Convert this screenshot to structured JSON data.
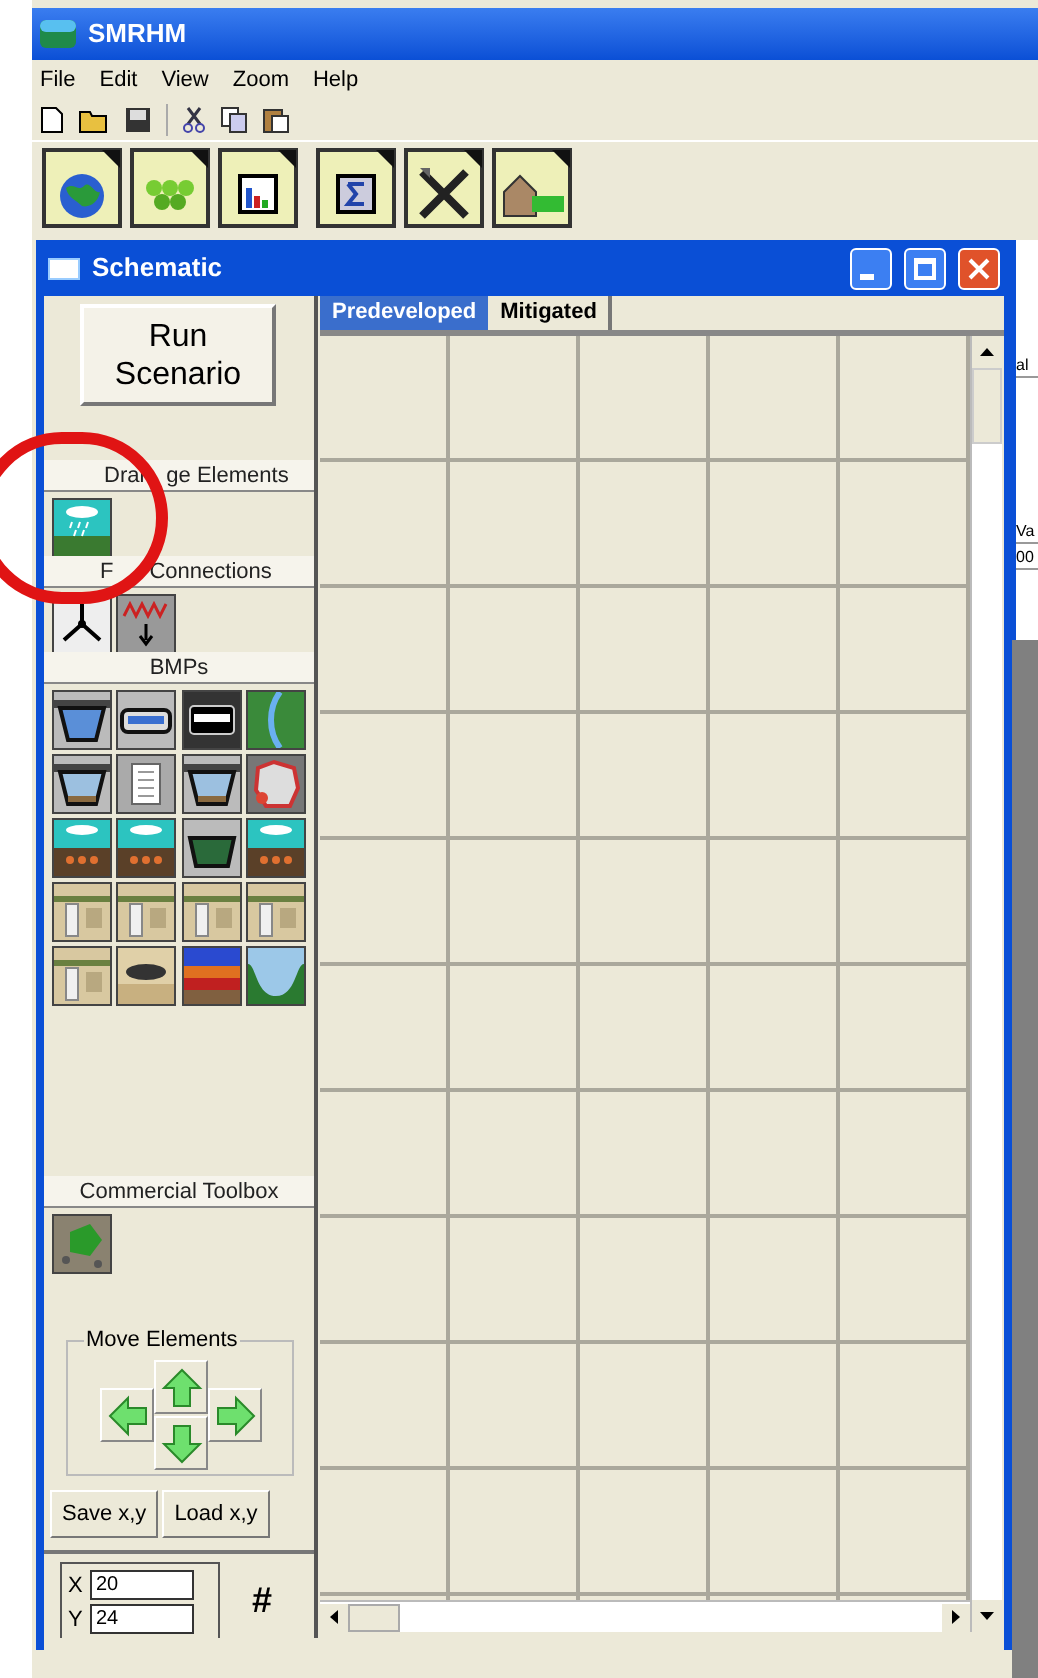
{
  "app": {
    "title": "SMRHM"
  },
  "menu": [
    {
      "label": "File"
    },
    {
      "label": "Edit"
    },
    {
      "label": "View"
    },
    {
      "label": "Zoom"
    },
    {
      "label": "Help"
    }
  ],
  "window": {
    "title": "Schematic"
  },
  "run_button": "Run Scenario",
  "sections": [
    {
      "title_parts": [
        "Drai",
        "ge Elements"
      ]
    },
    {
      "title_parts": [
        "F",
        "Connections"
      ]
    },
    {
      "title_parts": [
        "BMPs"
      ]
    },
    {
      "title_parts": [
        "Commercial Toolbox"
      ]
    }
  ],
  "move_group": {
    "label": "Move Elements"
  },
  "buttons": [
    "Save x,y",
    "Load x,y"
  ],
  "coords": [
    {
      "label": "X",
      "value": "20"
    },
    {
      "label": "Y",
      "value": "24"
    }
  ],
  "grid_button": "#",
  "tabs": [
    {
      "label": "Predeveloped",
      "selected": true
    },
    {
      "label": "Mitigated",
      "selected": false
    }
  ],
  "background_fragments": [
    "al",
    "Va",
    "00"
  ]
}
